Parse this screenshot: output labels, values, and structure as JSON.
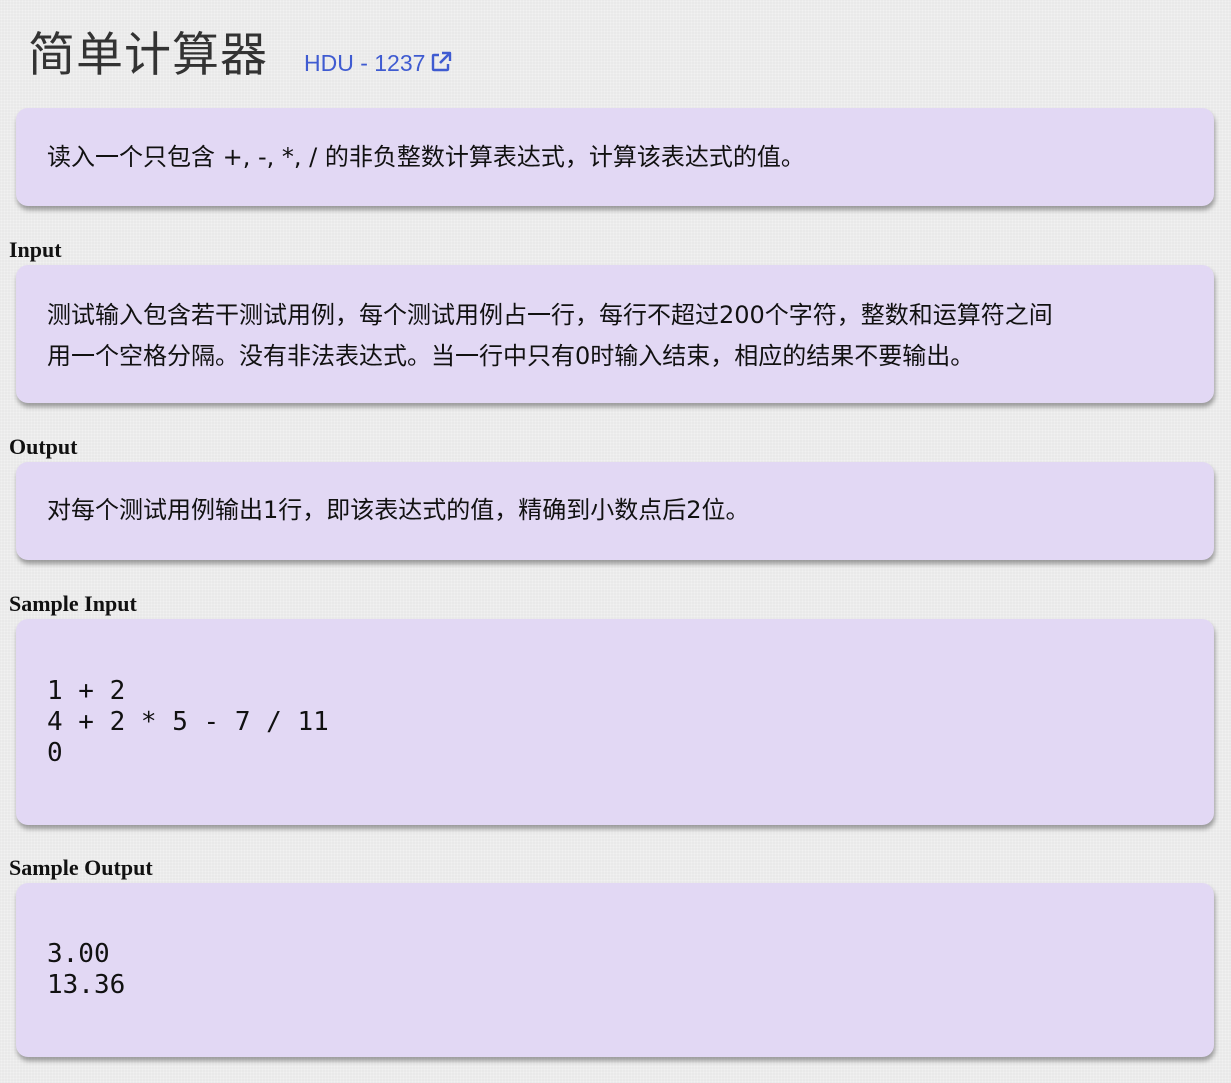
{
  "problem": {
    "title": "简单计算器",
    "source_label": "HDU - 1237",
    "source_icon": "external-link-icon",
    "link_color": "#3f5bd1",
    "panel_color": "#e2d8f4"
  },
  "description": {
    "text": "读入一个只包含 +, -, *, / 的非负整数计算表达式，计算该表达式的值。"
  },
  "input": {
    "heading": "Input",
    "lines": [
      "测试输入包含若干测试用例，每个测试用例占一行，每行不超过200个字符，整数和运算符之间",
      "用一个空格分隔。没有非法表达式。当一行中只有0时输入结束，相应的结果不要输出。"
    ]
  },
  "output": {
    "heading": "Output",
    "text": "对每个测试用例输出1行，即该表达式的值，精确到小数点后2位。"
  },
  "sample_input": {
    "heading": "Sample Input",
    "lines": [
      "1 + 2",
      "4 + 2 * 5 - 7 / 11",
      "0"
    ]
  },
  "sample_output": {
    "heading": "Sample Output",
    "lines": [
      "3.00",
      "13.36"
    ]
  }
}
